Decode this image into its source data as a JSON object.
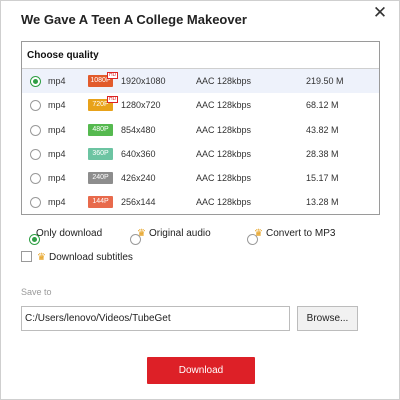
{
  "dialog": {
    "title": "We Gave A Teen A College Makeover",
    "close_icon": "close-icon"
  },
  "quality": {
    "header": "Choose quality",
    "rows": [
      {
        "format": "mp4",
        "badge": "1080P",
        "badge_color": "#e25b2b",
        "hd": "HD",
        "resolution": "1920x1080",
        "audio": "AAC 128kbps",
        "size": "219.50 M",
        "selected": true
      },
      {
        "format": "mp4",
        "badge": "720P",
        "badge_color": "#e8a21a",
        "hd": "HD",
        "resolution": "1280x720",
        "audio": "AAC 128kbps",
        "size": "68.12 M",
        "selected": false
      },
      {
        "format": "mp4",
        "badge": "480P",
        "badge_color": "#55b94f",
        "hd": "",
        "resolution": "854x480",
        "audio": "AAC 128kbps",
        "size": "43.82 M",
        "selected": false
      },
      {
        "format": "mp4",
        "badge": "360P",
        "badge_color": "#6cc4a2",
        "hd": "",
        "resolution": "640x360",
        "audio": "AAC 128kbps",
        "size": "28.38 M",
        "selected": false
      },
      {
        "format": "mp4",
        "badge": "240P",
        "badge_color": "#8d8d8d",
        "hd": "",
        "resolution": "426x240",
        "audio": "AAC 128kbps",
        "size": "15.17 M",
        "selected": false
      },
      {
        "format": "mp4",
        "badge": "144P",
        "badge_color": "#e86a4c",
        "hd": "",
        "resolution": "256x144",
        "audio": "AAC 128kbps",
        "size": "13.28 M",
        "selected": false
      }
    ]
  },
  "options": {
    "only_download": "Only download",
    "original_audio": "Original audio",
    "convert_mp3": "Convert to MP3",
    "download_subtitles": "Download subtitles",
    "crown_icon": "crown-icon",
    "crown_color": "#e49b12"
  },
  "save": {
    "label": "Save to",
    "path": "C:/Users/lenovo/Videos/TubeGet",
    "browse": "Browse..."
  },
  "download": {
    "label": "Download",
    "color": "#dd2027"
  }
}
